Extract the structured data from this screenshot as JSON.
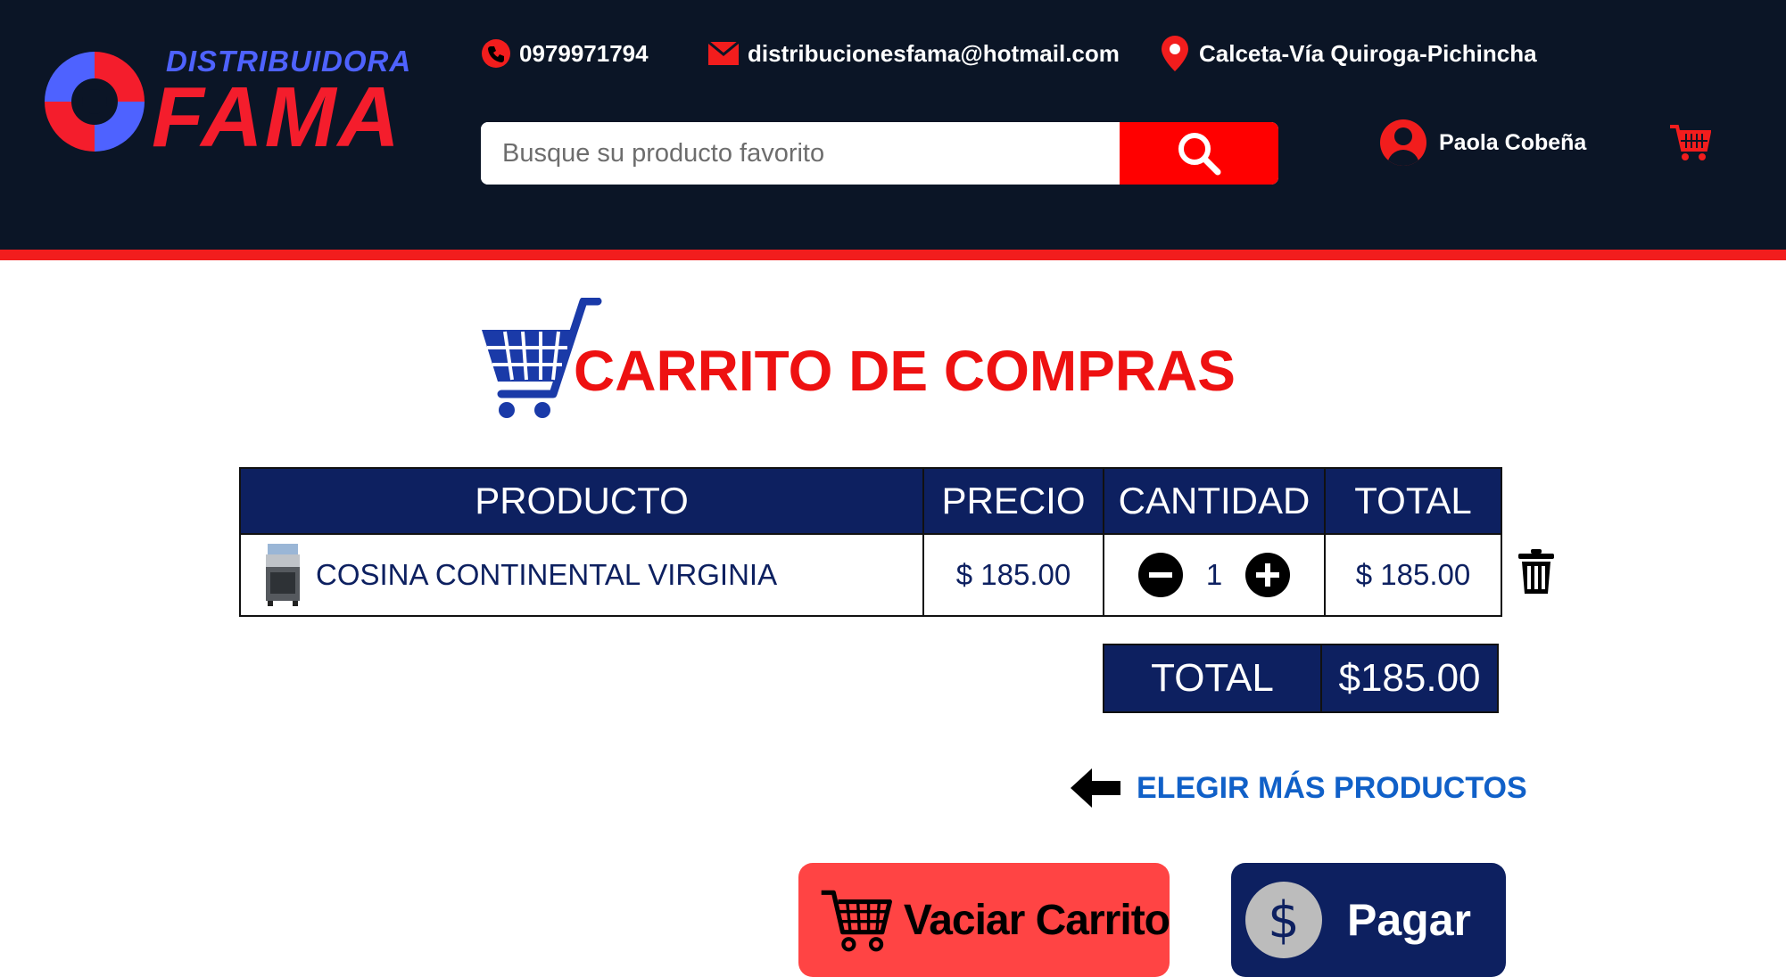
{
  "header": {
    "logo": {
      "top_text": "DISTRIBUIDORA",
      "main_text": "FAMA"
    },
    "phone": "0979971794",
    "email": "distribucionesfama@hotmail.com",
    "address": "Calceta-Vía Quiroga-Pichincha",
    "search": {
      "placeholder": "Busque su producto favorito",
      "value": ""
    },
    "user_name": "Paola Cobeña",
    "icons": [
      "phone-icon",
      "mail-icon",
      "location-pin-icon",
      "search-icon",
      "user-icon",
      "cart-icon"
    ]
  },
  "page": {
    "title": "CARRITO DE COMPRAS"
  },
  "table": {
    "headers": [
      "PRODUCTO",
      "PRECIO",
      "CANTIDAD",
      "TOTAL"
    ],
    "rows": [
      {
        "product": "COSINA CONTINENTAL VIRGINIA",
        "price": "$ 185.00",
        "quantity": "1",
        "total": "$ 185.00"
      }
    ]
  },
  "summary": {
    "label": "TOTAL",
    "value": "$185.00"
  },
  "actions": {
    "more_products": "ELEGIR MÁS PRODUCTOS",
    "empty_cart": "Vaciar Carrito",
    "pay": "Pagar",
    "pay_symbol": "$"
  },
  "colors": {
    "header_bg": "#0b1526",
    "accent_red": "#f21d1d",
    "navy": "#0d2060",
    "link_blue": "#1060c8"
  }
}
